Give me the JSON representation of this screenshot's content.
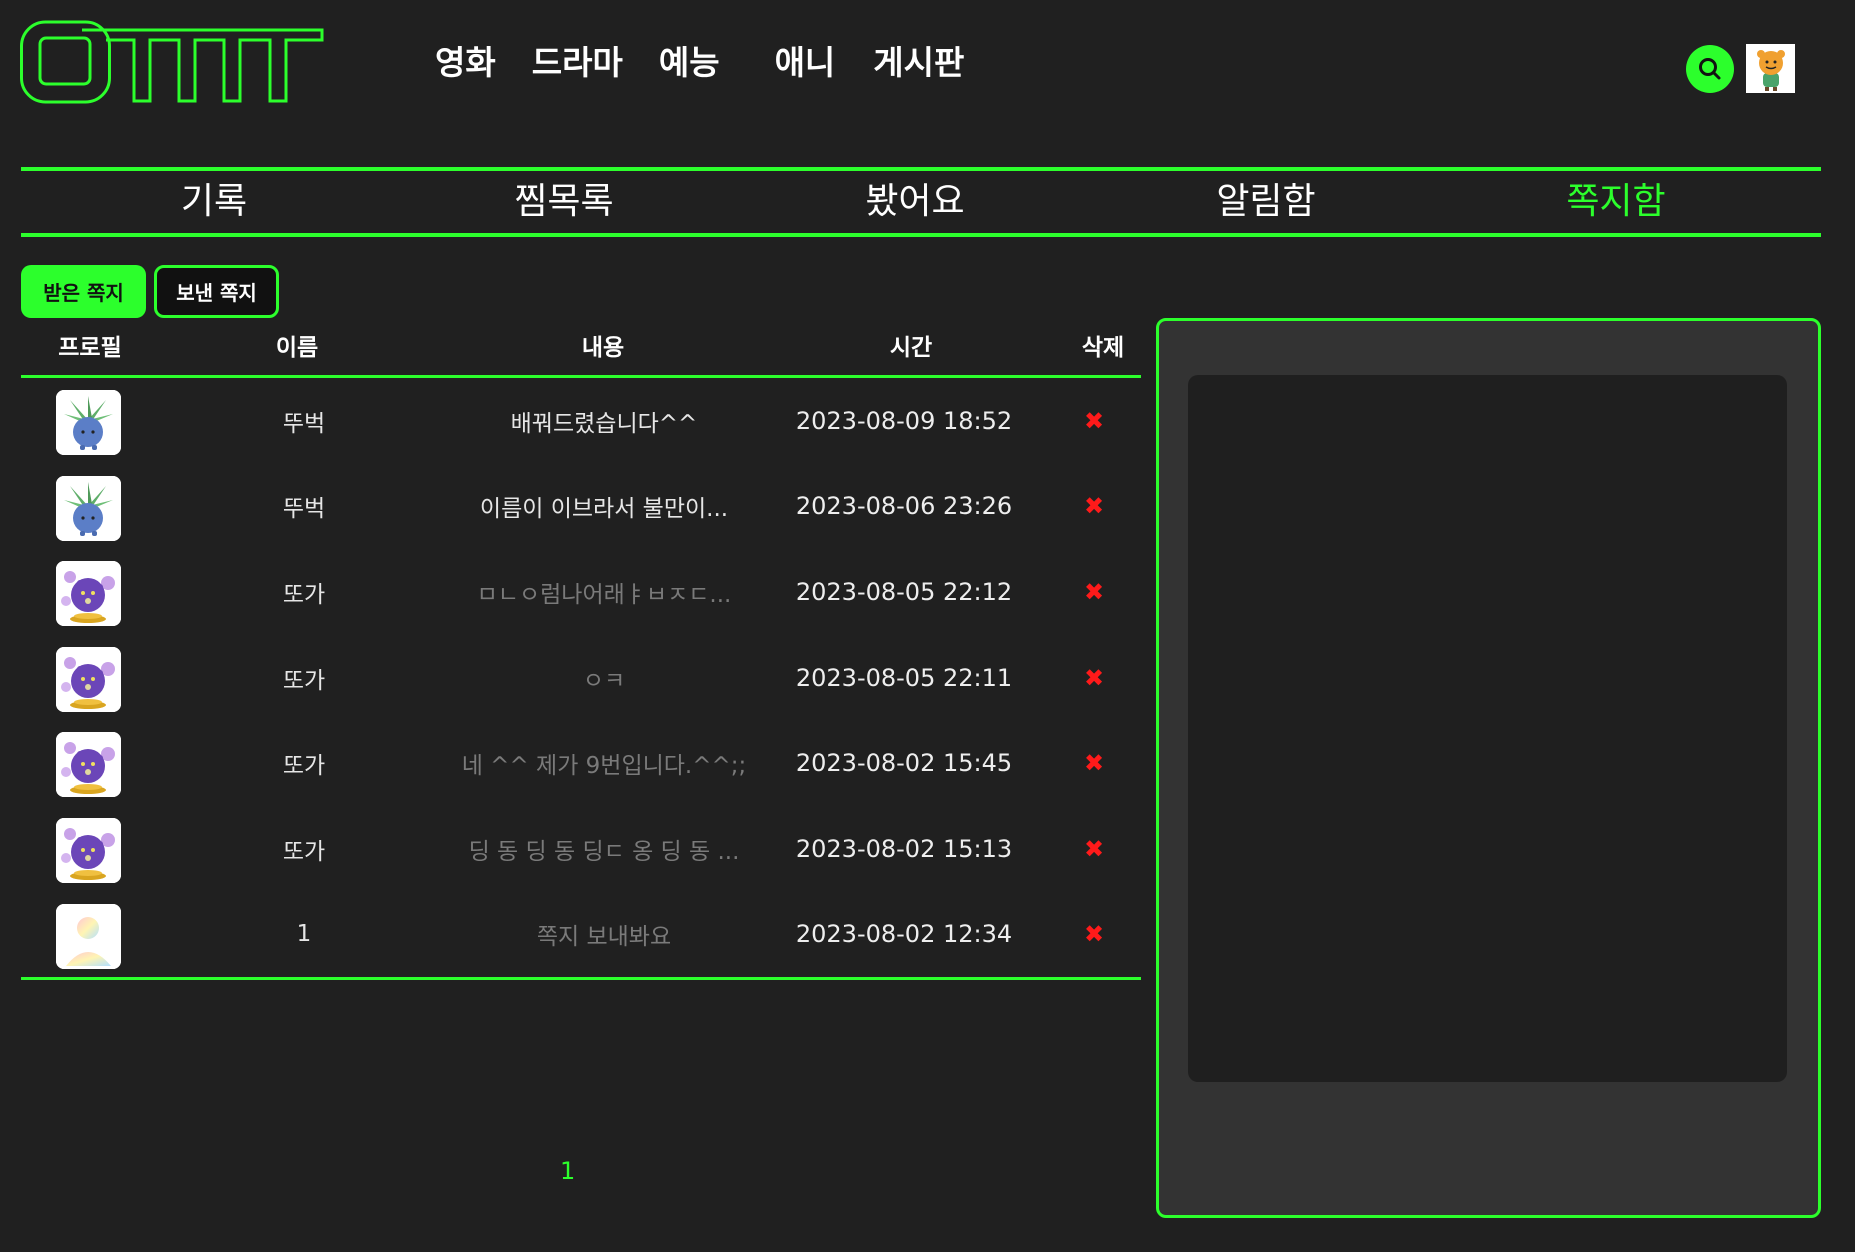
{
  "brand": {
    "logo_text": "OTTT",
    "accent": "#2cff2c",
    "background": "#202020"
  },
  "header": {
    "nav": [
      {
        "label": "영화"
      },
      {
        "label": "드라마"
      },
      {
        "label": "예능"
      },
      {
        "label": "애니"
      },
      {
        "label": "게시판"
      }
    ],
    "search_icon": "search-icon",
    "avatar_icon": "lion-avatar"
  },
  "mypage_tabs": [
    {
      "label": "기록",
      "active": false
    },
    {
      "label": "찜목록",
      "active": false
    },
    {
      "label": "봤어요",
      "active": false
    },
    {
      "label": "알림함",
      "active": false
    },
    {
      "label": "쪽지함",
      "active": true
    }
  ],
  "message_toggle": {
    "received": "받은 쪽지",
    "sent": "보낸 쪽지",
    "selected": "received"
  },
  "table": {
    "headers": {
      "profile": "프로필",
      "name": "이름",
      "content": "내용",
      "time": "시간",
      "delete": "삭제"
    },
    "rows": [
      {
        "avatar": "oddish",
        "name": "뚜벅",
        "content": "배꿔드렸습니다^^",
        "time": "2023-08-09 18:52",
        "read": false,
        "delete_icon": "✖"
      },
      {
        "avatar": "oddish",
        "name": "뚜벅",
        "content": "이름이 이브라서 불만이...",
        "time": "2023-08-06 23:26",
        "read": false,
        "delete_icon": "✖"
      },
      {
        "avatar": "koffing",
        "name": "또가",
        "content": "ㅁㄴㅇ럼나어래ㅑㅂㅈㄷ...",
        "time": "2023-08-05 22:12",
        "read": true,
        "delete_icon": "✖"
      },
      {
        "avatar": "koffing",
        "name": "또가",
        "content": "ㅇㅋ",
        "time": "2023-08-05 22:11",
        "read": true,
        "delete_icon": "✖"
      },
      {
        "avatar": "koffing",
        "name": "또가",
        "content": "네 ^^ 제가 9번입니다.^^;;",
        "time": "2023-08-02 15:45",
        "read": true,
        "delete_icon": "✖"
      },
      {
        "avatar": "koffing",
        "name": "또가",
        "content": "딩 동 딩 동 딩ㄷ 옹 딩 동 ...",
        "time": "2023-08-02 15:13",
        "read": true,
        "delete_icon": "✖"
      },
      {
        "avatar": "default-user",
        "name": "1",
        "content": "쪽지 보내봐요",
        "time": "2023-08-02 12:34",
        "read": true,
        "delete_icon": "✖"
      }
    ]
  },
  "pagination": {
    "pages": [
      "1"
    ],
    "current": "1"
  }
}
